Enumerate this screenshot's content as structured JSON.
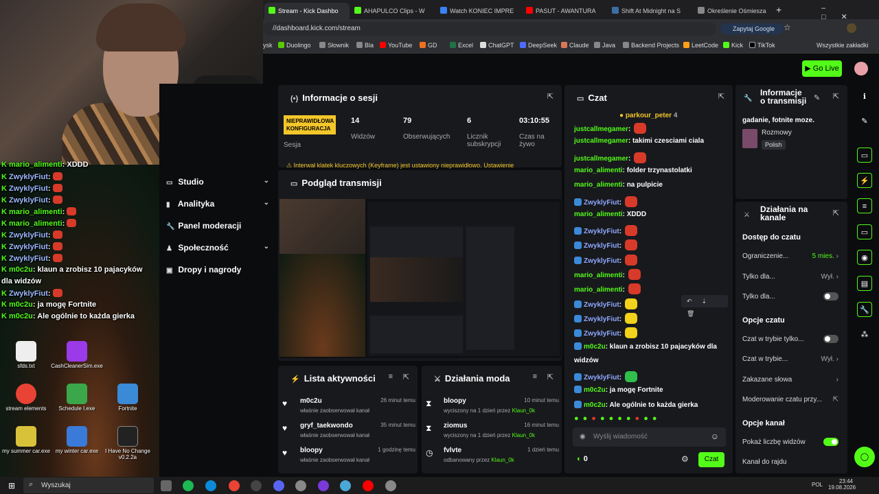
{
  "browser": {
    "tabs": [
      {
        "label": "Stream - Kick Dashbo",
        "color": "#53fc18",
        "active": true
      },
      {
        "label": "AHAPULCO Clips - W",
        "color": "#53fc18"
      },
      {
        "label": "Watch KONIEC IMPRE",
        "color": "#3b82f6"
      },
      {
        "label": "PASUT - AWANTURA",
        "color": "#ff0000"
      },
      {
        "label": "Shift At Midnight na S",
        "color": "#3b6ea5"
      },
      {
        "label": "Określenie Ośmiesza",
        "color": "#888888"
      }
    ],
    "new_tab": "+",
    "url": "//dashboard.kick.com/stream",
    "ask_google": "Zapytaj Google",
    "bookmarks": [
      "ysk",
      "Duolingo",
      "Słownik",
      "Bla",
      "YouTube",
      "GD",
      "Excel",
      "ChatGPT",
      "DeepSeek",
      "Claude",
      "Java",
      "Backend Projects",
      "LeetCode",
      "Kick",
      "TikTok"
    ],
    "all_bookmarks": "Wszystkie zakładki"
  },
  "kick": {
    "go_live": "Go Live",
    "nav": [
      {
        "label": "Studio",
        "chevron": true
      },
      {
        "label": "Analityka",
        "chevron": true
      },
      {
        "label": "Panel moderacji",
        "chevron": false
      },
      {
        "label": "Społeczność",
        "chevron": true
      },
      {
        "label": "Dropy i nagrody",
        "chevron": false
      }
    ],
    "session": {
      "title": "Informacje o sesji",
      "status": "NIEPRAWIDŁOWA KONFIGURACJA",
      "status_label": "Sesja",
      "stats": [
        {
          "value": "14",
          "label": "Widzów"
        },
        {
          "value": "79",
          "label": "Obserwujących"
        },
        {
          "value": "6",
          "label": "Licznik subskrypcji"
        },
        {
          "value": "03:10:55",
          "label": "Czas na żywo"
        }
      ],
      "warning": "Interwał klatek kluczowych (Keyframe) jest ustawiony nieprawidłowo. Ustawienie"
    },
    "preview": {
      "title": "Podgląd transmisji"
    },
    "activity": {
      "title": "Lista aktywności",
      "items": [
        {
          "name": "m0c2u",
          "time": "26 minut temu",
          "desc": "właśnie zaobserwował kanał"
        },
        {
          "name": "gryf_taekwondo",
          "time": "35 minut temu",
          "desc": "właśnie zaobserwował kanał"
        },
        {
          "name": "bloopy",
          "time": "1 godzinę temu",
          "desc": "właśnie zaobserwował kanał"
        }
      ]
    },
    "mod_actions": {
      "title": "Działania moda",
      "items": [
        {
          "name": "bloopy",
          "time": "10 minut temu",
          "desc": "wyciszony na 1 dzień przez",
          "by": "Klaun_0k"
        },
        {
          "name": "ziomus",
          "time": "16 minut temu",
          "desc": "wyciszony na 1 dzień przez",
          "by": "Klaun_0k"
        },
        {
          "name": "fvlvte",
          "time": "1 dzień temu",
          "desc": "odbanowany przez",
          "by": "Klaun_0k"
        }
      ]
    },
    "chat": {
      "title": "Czat",
      "pinned_user": "parkour_peter",
      "pinned_count": "4",
      "messages": [
        {
          "user": "justcallmegamer",
          "text": "",
          "emote": "#d83a2a"
        },
        {
          "user": "justcallmegamer",
          "text": "takimi czesciami ciala",
          "emote": ""
        },
        {
          "user": "justcallmegamer",
          "text": "",
          "emote": "#d83a2a"
        },
        {
          "user": "mario_alimenti",
          "text": "folder trzynastolatki",
          "emote": ""
        },
        {
          "user": "mario_alimenti",
          "text": "na pulpicie",
          "emote": ""
        },
        {
          "user": "ZwyklyFiut",
          "text": "",
          "emote": "#d83a2a",
          "badge": true
        },
        {
          "user": "mario_alimenti",
          "text": "XDDD",
          "emote": ""
        },
        {
          "user": "ZwyklyFiut",
          "text": "",
          "emote": "#d83a2a",
          "badge": true
        },
        {
          "user": "ZwyklyFiut",
          "text": "",
          "emote": "#d83a2a",
          "badge": true
        },
        {
          "user": "ZwyklyFiut",
          "text": "",
          "emote": "#d83a2a",
          "badge": true
        },
        {
          "user": "mario_alimenti",
          "text": "",
          "emote": "#d83a2a"
        },
        {
          "user": "mario_alimenti",
          "text": "",
          "emote": "#d83a2a"
        },
        {
          "user": "ZwyklyFiut",
          "text": "",
          "emote": "#f2d21a",
          "badge": true
        },
        {
          "user": "ZwyklyFiut",
          "text": "",
          "emote": "#f2d21a",
          "badge": true
        },
        {
          "user": "ZwyklyFiut",
          "text": "",
          "emote": "#f2d21a",
          "badge": true
        },
        {
          "user": "m0c2u",
          "text": "klaun a zrobisz 10 pajacyków dla",
          "emote": "",
          "badge": true
        },
        {
          "user": "",
          "text": "widzów",
          "emote": ""
        },
        {
          "user": "ZwyklyFiut",
          "text": "",
          "emote": "#2fbf4a",
          "badge": true
        },
        {
          "user": "m0c2u",
          "text": "ja mogę Fortnite",
          "emote": "",
          "badge": true
        },
        {
          "user": "m0c2u",
          "text": "Ale ogólnie to każda gierka",
          "emote": "",
          "badge": true
        }
      ],
      "placeholder": "Wyślij wiadomość",
      "count": "0",
      "send": "Czat"
    },
    "stream_info": {
      "title": "Informacje o transmisji",
      "description": "gadanie, fotnite moze.",
      "category": "Rozmowy",
      "language": "Polish"
    },
    "channel_actions": {
      "title": "Działania na kanale",
      "sections": [
        {
          "heading": "Dostęp do czatu",
          "rows": [
            {
              "label": "Ograniczenie...",
              "value": "5 mies.",
              "kind": "chevron"
            },
            {
              "label": "Tylko dla...",
              "value": "Wył.",
              "kind": "chevron"
            },
            {
              "label": "Tylko dla...",
              "value": "",
              "kind": "toggle-off"
            }
          ]
        },
        {
          "heading": "Opcje czatu",
          "rows": [
            {
              "label": "Czat w trybie tylko...",
              "value": "",
              "kind": "toggle-off"
            },
            {
              "label": "Czat w trybie...",
              "value": "Wył.",
              "kind": "chevron"
            },
            {
              "label": "Zakazane słowa",
              "value": "",
              "kind": "chevron"
            },
            {
              "label": "Moderowanie czatu przy...",
              "value": "",
              "kind": "external"
            }
          ]
        },
        {
          "heading": "Opcje kanał",
          "rows": [
            {
              "label": "Pokaż liczbę widzów",
              "value": "",
              "kind": "toggle-on"
            },
            {
              "label": "Kanał do rajdu",
              "value": "",
              "kind": "none"
            }
          ]
        }
      ]
    }
  },
  "overlay_chat": [
    {
      "user": "mario_alimenti",
      "text": "XDDD"
    },
    {
      "user": "ZwyklyFiut",
      "text": ""
    },
    {
      "user": "ZwyklyFiut",
      "text": ""
    },
    {
      "user": "ZwyklyFiut",
      "text": ""
    },
    {
      "user": "mario_alimenti",
      "text": ""
    },
    {
      "user": "mario_alimenti",
      "text": ""
    },
    {
      "user": "ZwyklyFiut",
      "text": ""
    },
    {
      "user": "ZwyklyFiut",
      "text": ""
    },
    {
      "user": "ZwyklyFiut",
      "text": ""
    },
    {
      "user": "m0c2u",
      "text": "klaun a zrobisz 10 pajacyków"
    },
    {
      "user": "",
      "text": "dla widzów"
    },
    {
      "user": "ZwyklyFiut",
      "text": ""
    },
    {
      "user": "m0c2u",
      "text": "ja mogę Fortnite"
    },
    {
      "user": "m0c2u",
      "text": "Ale ogólnie to każda gierka"
    }
  ],
  "desktop_icons": [
    "sfds.txt",
    "CashCleanerSim.exe",
    "stream elements",
    "Schedule I.exe",
    "Fortnite",
    "my summer car.exe",
    "my winter car.exe",
    "I Have No Change v0.2.2a"
  ],
  "taskbar": {
    "search": "Wyszukaj",
    "lang": "POL",
    "time": "23:44",
    "date": "19.08.2026"
  }
}
